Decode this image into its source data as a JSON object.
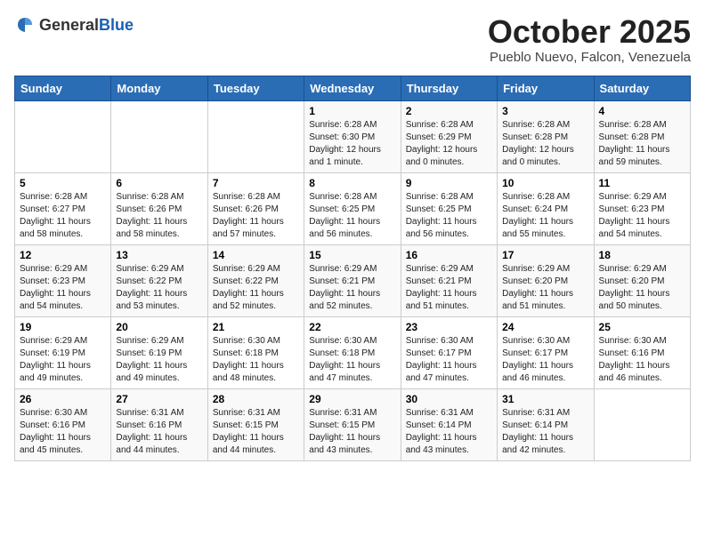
{
  "header": {
    "logo_general": "General",
    "logo_blue": "Blue",
    "month_title": "October 2025",
    "location": "Pueblo Nuevo, Falcon, Venezuela"
  },
  "days_of_week": [
    "Sunday",
    "Monday",
    "Tuesday",
    "Wednesday",
    "Thursday",
    "Friday",
    "Saturday"
  ],
  "weeks": [
    [
      {
        "day": "",
        "info": ""
      },
      {
        "day": "",
        "info": ""
      },
      {
        "day": "",
        "info": ""
      },
      {
        "day": "1",
        "info": "Sunrise: 6:28 AM\nSunset: 6:30 PM\nDaylight: 12 hours and 1 minute."
      },
      {
        "day": "2",
        "info": "Sunrise: 6:28 AM\nSunset: 6:29 PM\nDaylight: 12 hours and 0 minutes."
      },
      {
        "day": "3",
        "info": "Sunrise: 6:28 AM\nSunset: 6:28 PM\nDaylight: 12 hours and 0 minutes."
      },
      {
        "day": "4",
        "info": "Sunrise: 6:28 AM\nSunset: 6:28 PM\nDaylight: 11 hours and 59 minutes."
      }
    ],
    [
      {
        "day": "5",
        "info": "Sunrise: 6:28 AM\nSunset: 6:27 PM\nDaylight: 11 hours and 58 minutes."
      },
      {
        "day": "6",
        "info": "Sunrise: 6:28 AM\nSunset: 6:26 PM\nDaylight: 11 hours and 58 minutes."
      },
      {
        "day": "7",
        "info": "Sunrise: 6:28 AM\nSunset: 6:26 PM\nDaylight: 11 hours and 57 minutes."
      },
      {
        "day": "8",
        "info": "Sunrise: 6:28 AM\nSunset: 6:25 PM\nDaylight: 11 hours and 56 minutes."
      },
      {
        "day": "9",
        "info": "Sunrise: 6:28 AM\nSunset: 6:25 PM\nDaylight: 11 hours and 56 minutes."
      },
      {
        "day": "10",
        "info": "Sunrise: 6:28 AM\nSunset: 6:24 PM\nDaylight: 11 hours and 55 minutes."
      },
      {
        "day": "11",
        "info": "Sunrise: 6:29 AM\nSunset: 6:23 PM\nDaylight: 11 hours and 54 minutes."
      }
    ],
    [
      {
        "day": "12",
        "info": "Sunrise: 6:29 AM\nSunset: 6:23 PM\nDaylight: 11 hours and 54 minutes."
      },
      {
        "day": "13",
        "info": "Sunrise: 6:29 AM\nSunset: 6:22 PM\nDaylight: 11 hours and 53 minutes."
      },
      {
        "day": "14",
        "info": "Sunrise: 6:29 AM\nSunset: 6:22 PM\nDaylight: 11 hours and 52 minutes."
      },
      {
        "day": "15",
        "info": "Sunrise: 6:29 AM\nSunset: 6:21 PM\nDaylight: 11 hours and 52 minutes."
      },
      {
        "day": "16",
        "info": "Sunrise: 6:29 AM\nSunset: 6:21 PM\nDaylight: 11 hours and 51 minutes."
      },
      {
        "day": "17",
        "info": "Sunrise: 6:29 AM\nSunset: 6:20 PM\nDaylight: 11 hours and 51 minutes."
      },
      {
        "day": "18",
        "info": "Sunrise: 6:29 AM\nSunset: 6:20 PM\nDaylight: 11 hours and 50 minutes."
      }
    ],
    [
      {
        "day": "19",
        "info": "Sunrise: 6:29 AM\nSunset: 6:19 PM\nDaylight: 11 hours and 49 minutes."
      },
      {
        "day": "20",
        "info": "Sunrise: 6:29 AM\nSunset: 6:19 PM\nDaylight: 11 hours and 49 minutes."
      },
      {
        "day": "21",
        "info": "Sunrise: 6:30 AM\nSunset: 6:18 PM\nDaylight: 11 hours and 48 minutes."
      },
      {
        "day": "22",
        "info": "Sunrise: 6:30 AM\nSunset: 6:18 PM\nDaylight: 11 hours and 47 minutes."
      },
      {
        "day": "23",
        "info": "Sunrise: 6:30 AM\nSunset: 6:17 PM\nDaylight: 11 hours and 47 minutes."
      },
      {
        "day": "24",
        "info": "Sunrise: 6:30 AM\nSunset: 6:17 PM\nDaylight: 11 hours and 46 minutes."
      },
      {
        "day": "25",
        "info": "Sunrise: 6:30 AM\nSunset: 6:16 PM\nDaylight: 11 hours and 46 minutes."
      }
    ],
    [
      {
        "day": "26",
        "info": "Sunrise: 6:30 AM\nSunset: 6:16 PM\nDaylight: 11 hours and 45 minutes."
      },
      {
        "day": "27",
        "info": "Sunrise: 6:31 AM\nSunset: 6:16 PM\nDaylight: 11 hours and 44 minutes."
      },
      {
        "day": "28",
        "info": "Sunrise: 6:31 AM\nSunset: 6:15 PM\nDaylight: 11 hours and 44 minutes."
      },
      {
        "day": "29",
        "info": "Sunrise: 6:31 AM\nSunset: 6:15 PM\nDaylight: 11 hours and 43 minutes."
      },
      {
        "day": "30",
        "info": "Sunrise: 6:31 AM\nSunset: 6:14 PM\nDaylight: 11 hours and 43 minutes."
      },
      {
        "day": "31",
        "info": "Sunrise: 6:31 AM\nSunset: 6:14 PM\nDaylight: 11 hours and 42 minutes."
      },
      {
        "day": "",
        "info": ""
      }
    ]
  ]
}
